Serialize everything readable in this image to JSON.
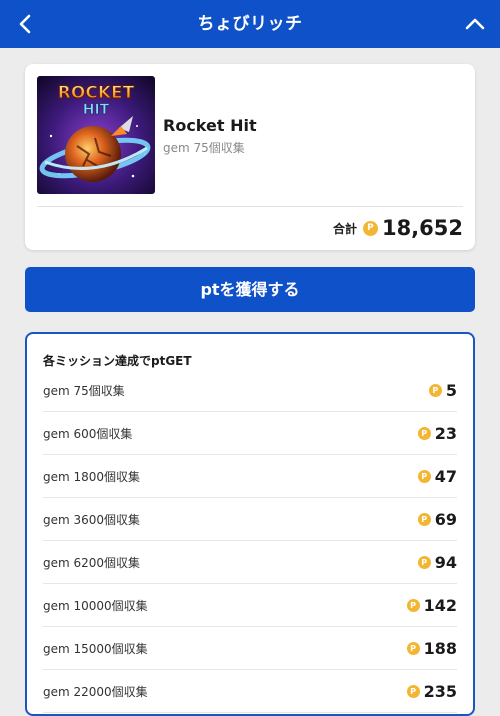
{
  "header": {
    "title": "ちょびリッチ",
    "back_icon": "chevron-left-icon",
    "collapse_icon": "chevron-up-icon"
  },
  "app": {
    "name": "Rocket Hit",
    "subtitle": "gem 75個収集",
    "thumbnail_text_line1": "ROCKET",
    "thumbnail_text_line2": "HIT",
    "total_label": "合計",
    "total_points": "18,652",
    "coin_symbol": "P"
  },
  "cta": {
    "label": "ptを獲得する"
  },
  "missions": {
    "heading": "各ミッション達成でptGET",
    "coin_symbol": "P",
    "items": [
      {
        "name": "gem 75個収集",
        "points": "5"
      },
      {
        "name": "gem 600個収集",
        "points": "23"
      },
      {
        "name": "gem 1800個収集",
        "points": "47"
      },
      {
        "name": "gem 3600個収集",
        "points": "69"
      },
      {
        "name": "gem 6200個収集",
        "points": "94"
      },
      {
        "name": "gem 10000個収集",
        "points": "142"
      },
      {
        "name": "gem 15000個収集",
        "points": "188"
      },
      {
        "name": "gem 22000個収集",
        "points": "235"
      }
    ]
  },
  "colors": {
    "brand_blue": "#0f51c8",
    "coin_gold": "#f2b632",
    "background": "#ececec"
  }
}
